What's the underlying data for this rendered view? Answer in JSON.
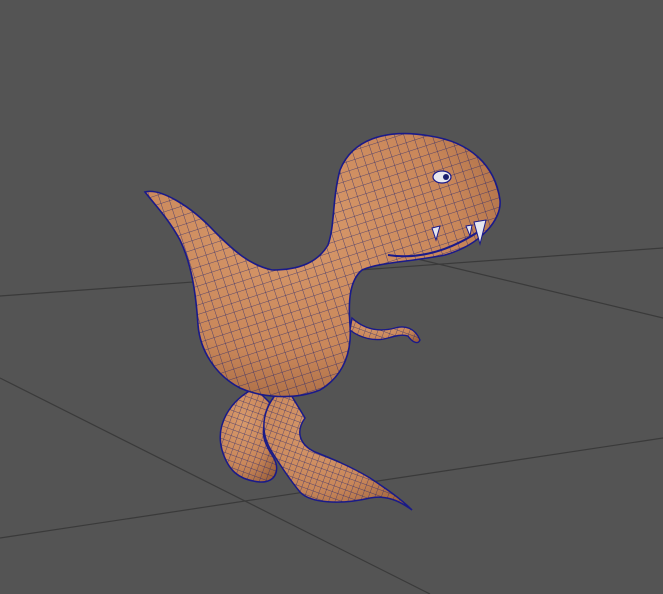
{
  "viewport": {
    "background_color": "#545454",
    "grid_line_color": "#3a3a3a",
    "grid_visible": true
  },
  "model": {
    "subject": "dinosaur",
    "display_mode": "wireframe-on-shaded",
    "surface_color": "#c9875a",
    "surface_shadow_color": "#9a5f3a",
    "wireframe_color": "#1a1f6e",
    "outline_color": "#1a1a8a",
    "eye_color": "#e8e8f0",
    "teeth_color": "#e6e6ee"
  }
}
